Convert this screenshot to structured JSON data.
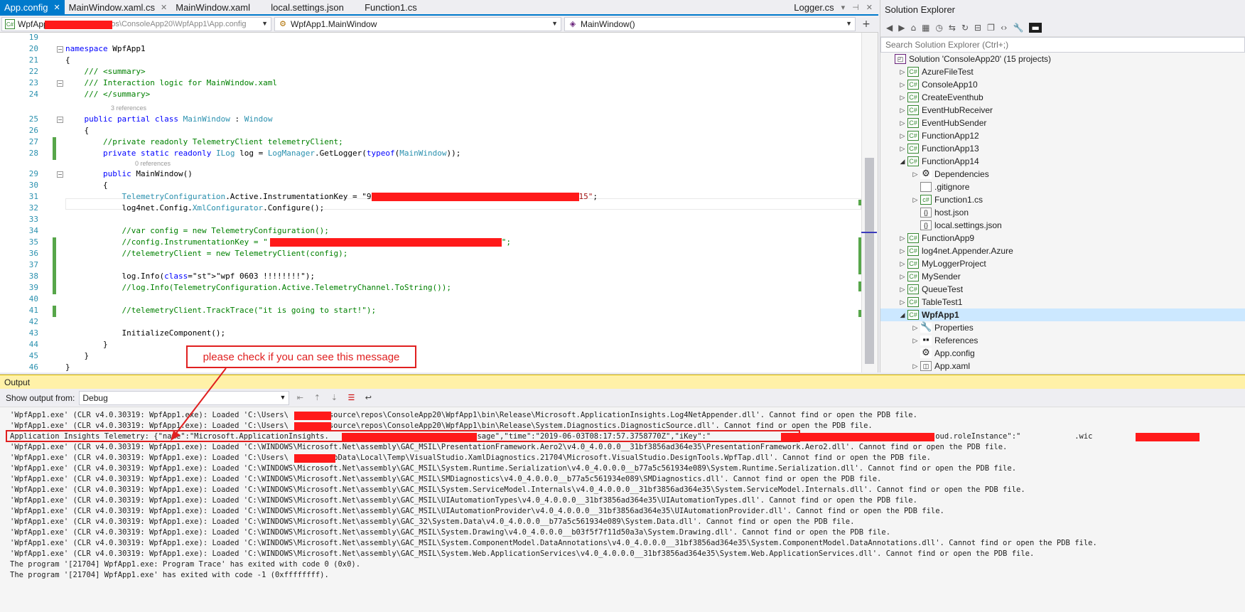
{
  "tabs": [
    {
      "label": "App.config",
      "active": true
    },
    {
      "label": "MainWindow.xaml.cs",
      "active": false
    },
    {
      "label": "MainWindow.xaml",
      "active": false
    },
    {
      "label": "local.settings.json",
      "active": false
    },
    {
      "label": "Function1.cs",
      "active": false
    }
  ],
  "tab_right": {
    "label": "Logger.cs"
  },
  "nav": {
    "project": "WpfApp1",
    "type": "WpfApp1.MainWindow",
    "member": "MainWindow()",
    "tooltip": "C:\\Users\\...\\repos\\ConsoleApp20\\WpfApp1\\App.config"
  },
  "code": {
    "lines": [
      {
        "n": "19",
        "html": ""
      },
      {
        "n": "20",
        "t": "namespace WpfApp1"
      },
      {
        "n": "21",
        "t": "{"
      },
      {
        "n": "22",
        "t": "    /// <summary>"
      },
      {
        "n": "23",
        "t": "    /// Interaction logic for MainWindow.xaml"
      },
      {
        "n": "24",
        "t": "    /// </summary>"
      },
      {
        "n": "25",
        "t": "    public partial class MainWindow : Window"
      },
      {
        "n": "26",
        "t": "    {"
      },
      {
        "n": "27",
        "t": "        //private readonly TelemetryClient telemetryClient;"
      },
      {
        "n": "28",
        "t": "        private static readonly ILog log = LogManager.GetLogger(typeof(MainWindow));"
      },
      {
        "n": "29",
        "t": "        public MainWindow()"
      },
      {
        "n": "30",
        "t": "        {"
      },
      {
        "n": "31",
        "t": "            TelemetryConfiguration.Active.InstrumentationKey = \"9"
      },
      {
        "n": "32",
        "t": "            log4net.Config.XmlConfigurator.Configure();"
      },
      {
        "n": "33",
        "t": ""
      },
      {
        "n": "34",
        "t": "            //var config = new TelemetryConfiguration();"
      },
      {
        "n": "35",
        "t": "            //config.InstrumentationKey = \""
      },
      {
        "n": "36",
        "t": "            //telemetryClient = new TelemetryClient(config);"
      },
      {
        "n": "37",
        "t": ""
      },
      {
        "n": "38",
        "t": "            log.Info(\"wpf 0603 !!!!!!!!\");"
      },
      {
        "n": "39",
        "t": "            //log.Info(TelemetryConfiguration.Active.TelemetryChannel.ToString());"
      },
      {
        "n": "40",
        "t": ""
      },
      {
        "n": "41",
        "t": "            //telemetryClient.TrackTrace(\"it is going to start!\");"
      },
      {
        "n": "42",
        "t": ""
      },
      {
        "n": "43",
        "t": "            InitializeComponent();"
      },
      {
        "n": "44",
        "t": "        }"
      },
      {
        "n": "45",
        "t": "    }"
      },
      {
        "n": "46",
        "t": "}"
      }
    ],
    "refs_class": "3 references",
    "refs_ctor": "0 references",
    "key_suffix": "15\";",
    "config_suffix": "\";"
  },
  "annotation": "please check if you can see this message",
  "solution_explorer": {
    "title": "Solution Explorer",
    "search_placeholder": "Search Solution Explorer (Ctrl+;)",
    "items": [
      {
        "label": "Solution 'ConsoleApp20' (15 projects)",
        "level": 0,
        "icon": "solution"
      },
      {
        "label": "AzureFileTest",
        "level": 1,
        "icon": "cs"
      },
      {
        "label": "ConsoleApp10",
        "level": 1,
        "icon": "cs"
      },
      {
        "label": "CreateEventhub",
        "level": 1,
        "icon": "cs"
      },
      {
        "label": "EventHubReceiver",
        "level": 1,
        "icon": "cs"
      },
      {
        "label": "EventHubSender",
        "level": 1,
        "icon": "cs"
      },
      {
        "label": "FunctionApp12",
        "level": 1,
        "icon": "cs"
      },
      {
        "label": "FunctionApp13",
        "level": 1,
        "icon": "cs"
      },
      {
        "label": "FunctionApp14",
        "level": 1,
        "icon": "cs",
        "expanded": true
      },
      {
        "label": "Dependencies",
        "level": 2,
        "icon": "deps"
      },
      {
        "label": ".gitignore",
        "level": 2,
        "icon": "file"
      },
      {
        "label": "Function1.cs",
        "level": 2,
        "icon": "csfile"
      },
      {
        "label": "host.json",
        "level": 2,
        "icon": "json"
      },
      {
        "label": "local.settings.json",
        "level": 2,
        "icon": "json"
      },
      {
        "label": "FunctionApp9",
        "level": 1,
        "icon": "cs"
      },
      {
        "label": "log4net.Appender.Azure",
        "level": 1,
        "icon": "cs"
      },
      {
        "label": "MyLoggerProject",
        "level": 1,
        "icon": "cs"
      },
      {
        "label": "MySender",
        "level": 1,
        "icon": "cs"
      },
      {
        "label": "QueueTest",
        "level": 1,
        "icon": "cs"
      },
      {
        "label": "TableTest1",
        "level": 1,
        "icon": "cs"
      },
      {
        "label": "WpfApp1",
        "level": 1,
        "icon": "cs",
        "expanded": true,
        "selected": true
      },
      {
        "label": "Properties",
        "level": 2,
        "icon": "props"
      },
      {
        "label": "References",
        "level": 2,
        "icon": "refs"
      },
      {
        "label": "App.config",
        "level": 2,
        "icon": "config"
      },
      {
        "label": "App.xaml",
        "level": 2,
        "icon": "xaml"
      }
    ]
  },
  "output": {
    "title": "Output",
    "show_from_label": "Show output from:",
    "show_from_value": "Debug",
    "lines": [
      "'WpfApp1.exe' (CLR v4.0.30319: WpfApp1.exe): Loaded 'C:\\Users\\       g\\source\\repos\\ConsoleApp20\\WpfApp1\\bin\\Release\\Microsoft.ApplicationInsights.Log4NetAppender.dll'. Cannot find or open the PDB file.",
      "'WpfApp1.exe' (CLR v4.0.30319: WpfApp1.exe): Loaded 'C:\\Users\\        \\source\\repos\\ConsoleApp20\\WpfApp1\\bin\\Release\\System.Diagnostics.DiagnosticSource.dll'. Cannot find or open the PDB file.",
      "Application Insights Telemetry: {\"name\":\"Microsoft.ApplicationInsights.                             .Message\",\"time\":\"2019-06-03T08:17:57.3758770Z\",\"iKey\":\"                             36915\",\"tags\":{\"ai.cloud.roleInstance\":\"            .wic",
      "'WpfApp1.exe' (CLR v4.0.30319: WpfApp1.exe): Loaded 'C:\\WINDOWS\\Microsoft.Net\\assembly\\GAC_MSIL\\PresentationFramework.Aero2\\v4.0_4.0.0.0__31bf3856ad364e35\\PresentationFramework.Aero2.dll'. Cannot find or open the PDB file.",
      "'WpfApp1.exe' (CLR v4.0.30319: WpfApp1.exe): Loaded 'C:\\Users\\        AppData\\Local\\Temp\\VisualStudio.XamlDiagnostics.21704\\Microsoft.VisualStudio.DesignTools.WpfTap.dll'. Cannot find or open the PDB file.",
      "'WpfApp1.exe' (CLR v4.0.30319: WpfApp1.exe): Loaded 'C:\\WINDOWS\\Microsoft.Net\\assembly\\GAC_MSIL\\System.Runtime.Serialization\\v4.0_4.0.0.0__b77a5c561934e089\\System.Runtime.Serialization.dll'. Cannot find or open the PDB file.",
      "'WpfApp1.exe' (CLR v4.0.30319: WpfApp1.exe): Loaded 'C:\\WINDOWS\\Microsoft.Net\\assembly\\GAC_MSIL\\SMDiagnostics\\v4.0_4.0.0.0__b77a5c561934e089\\SMDiagnostics.dll'. Cannot find or open the PDB file.",
      "'WpfApp1.exe' (CLR v4.0.30319: WpfApp1.exe): Loaded 'C:\\WINDOWS\\Microsoft.Net\\assembly\\GAC_MSIL\\System.ServiceModel.Internals\\v4.0_4.0.0.0__31bf3856ad364e35\\System.ServiceModel.Internals.dll'. Cannot find or open the PDB file.",
      "'WpfApp1.exe' (CLR v4.0.30319: WpfApp1.exe): Loaded 'C:\\WINDOWS\\Microsoft.Net\\assembly\\GAC_MSIL\\UIAutomationTypes\\v4.0_4.0.0.0__31bf3856ad364e35\\UIAutomationTypes.dll'. Cannot find or open the PDB file.",
      "'WpfApp1.exe' (CLR v4.0.30319: WpfApp1.exe): Loaded 'C:\\WINDOWS\\Microsoft.Net\\assembly\\GAC_MSIL\\UIAutomationProvider\\v4.0_4.0.0.0__31bf3856ad364e35\\UIAutomationProvider.dll'. Cannot find or open the PDB file.",
      "'WpfApp1.exe' (CLR v4.0.30319: WpfApp1.exe): Loaded 'C:\\WINDOWS\\Microsoft.Net\\assembly\\GAC_32\\System.Data\\v4.0_4.0.0.0__b77a5c561934e089\\System.Data.dll'. Cannot find or open the PDB file.",
      "'WpfApp1.exe' (CLR v4.0.30319: WpfApp1.exe): Loaded 'C:\\WINDOWS\\Microsoft.Net\\assembly\\GAC_MSIL\\System.Drawing\\v4.0_4.0.0.0__b03f5f7f11d50a3a\\System.Drawing.dll'. Cannot find or open the PDB file.",
      "'WpfApp1.exe' (CLR v4.0.30319: WpfApp1.exe): Loaded 'C:\\WINDOWS\\Microsoft.Net\\assembly\\GAC_MSIL\\System.ComponentModel.DataAnnotations\\v4.0_4.0.0.0__31bf3856ad364e35\\System.ComponentModel.DataAnnotations.dll'. Cannot find or open the PDB file.",
      "'WpfApp1.exe' (CLR v4.0.30319: WpfApp1.exe): Loaded 'C:\\WINDOWS\\Microsoft.Net\\assembly\\GAC_MSIL\\System.Web.ApplicationServices\\v4.0_4.0.0.0__31bf3856ad364e35\\System.Web.ApplicationServices.dll'. Cannot find or open the PDB file.",
      "The program '[21704] WpfApp1.exe: Program Trace' has exited with code 0 (0x0).",
      "The program '[21704] WpfApp1.exe' has exited with code -1 (0xffffffff)."
    ]
  },
  "colors": {
    "accent": "#007acc",
    "annotation": "#e02020",
    "output_header": "#fff1a8",
    "redaction": "#ff1a1a"
  }
}
